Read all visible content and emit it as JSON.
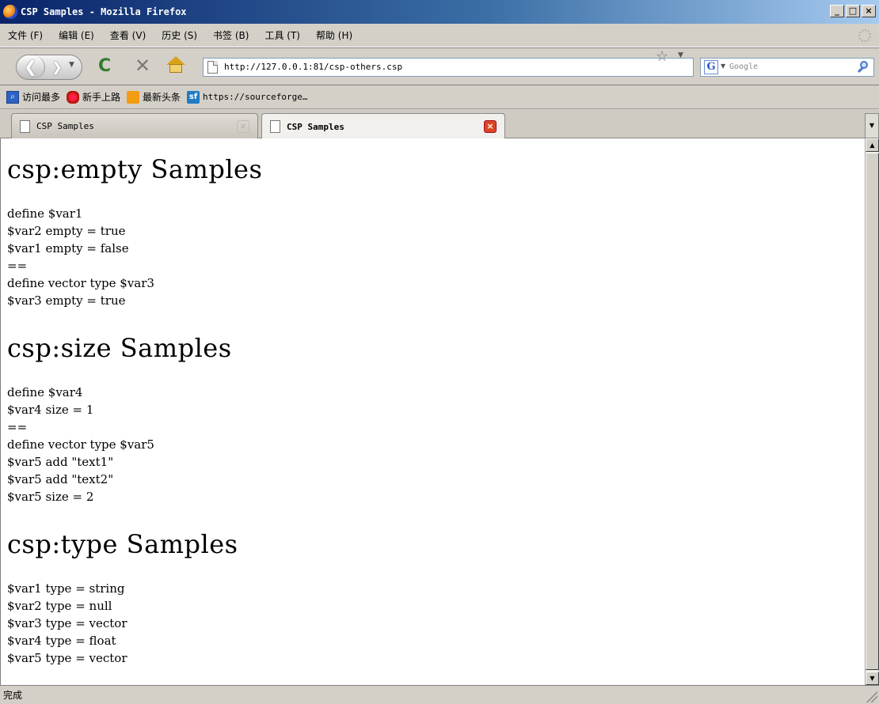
{
  "window": {
    "title": "CSP Samples - Mozilla Firefox"
  },
  "menu": [
    "文件 (F)",
    "编辑 (E)",
    "查看 (V)",
    "历史 (S)",
    "书签 (B)",
    "工具 (T)",
    "帮助 (H)"
  ],
  "navbar": {
    "url": "http://127.0.0.1:81/csp-others.csp",
    "search_placeholder": "Google"
  },
  "bookmarks": [
    "访问最多",
    "新手上路",
    "最新头条",
    "https://sourceforge…"
  ],
  "tabs": [
    {
      "title": "CSP Samples",
      "active": false
    },
    {
      "title": "CSP Samples",
      "active": true
    }
  ],
  "content": {
    "sections": [
      {
        "heading": "csp:empty Samples",
        "lines": [
          "define $var1",
          "$var2 empty = true",
          "$var1 empty = false",
          "==",
          "define vector type $var3",
          "$var3 empty = true"
        ]
      },
      {
        "heading": "csp:size Samples",
        "lines": [
          "define $var4",
          "$var4 size = 1",
          "==",
          "define vector type $var5",
          "$var5 add \"text1\"",
          "$var5 add \"text2\"",
          "$var5 size = 2"
        ]
      },
      {
        "heading": "csp:type Samples",
        "lines": [
          "$var1 type = string",
          "$var2 type = null",
          "$var3 type = vector",
          "$var4 type = float",
          "$var5 type = vector"
        ]
      }
    ]
  },
  "status": {
    "text": "完成"
  }
}
